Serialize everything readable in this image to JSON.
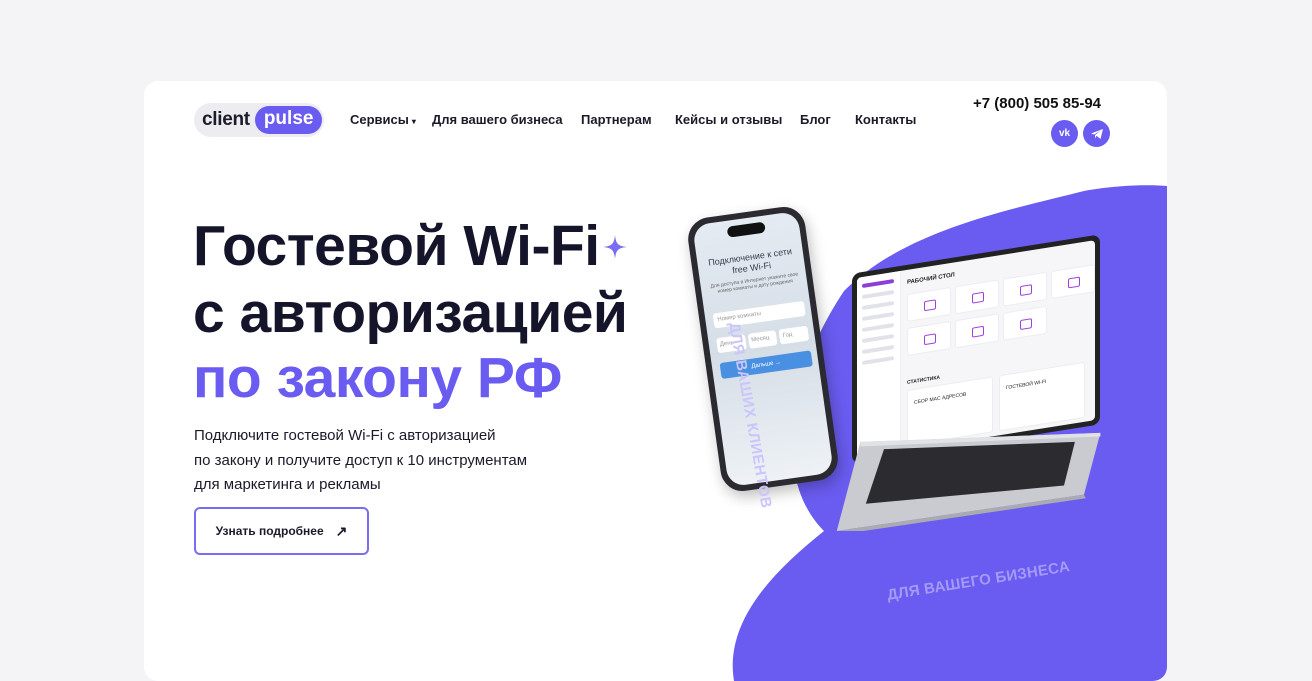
{
  "logo": {
    "word1": "client",
    "word2": "pulse"
  },
  "nav": [
    {
      "label": "Сервисы",
      "has_dropdown": true
    },
    {
      "label": "Для вашего бизнеса"
    },
    {
      "label": "Партнерам"
    },
    {
      "label": "Кейсы и отзывы"
    },
    {
      "label": "Блог"
    },
    {
      "label": "Контакты"
    }
  ],
  "contacts": {
    "phone": "+7 (800) 505 85-94",
    "social": [
      "vk-icon",
      "telegram-icon"
    ]
  },
  "hero": {
    "line1": "Гостевой Wi-Fi",
    "line2": "с авторизацией",
    "line3": "по закону РФ",
    "description": [
      "Подключите гостевой Wi-Fi с авторизацией",
      "по закону и получите доступ к 10 инструментам",
      "для маркетинга и рекламы"
    ],
    "cta_label": "Узнать подробнее"
  },
  "decor": {
    "vertical_caption": "ДЛЯ ВАШИХ КЛИЕНТОВ",
    "horizontal_caption": "ДЛЯ ВАШЕГО БИЗНЕСА"
  },
  "phone_mock": {
    "title": "Подключение к сети free Wi-Fi",
    "desc": "Для доступа в Интернет укажите свое номер комнаты и дату рождения",
    "room_placeholder": "Номер комнаты",
    "day": "День",
    "month": "Месяц",
    "year": "Год",
    "button": "Дальше →"
  },
  "laptop_mock": {
    "title": "РАБОЧИЙ СТОЛ",
    "stats": "СТАТИСТИКА",
    "card1": "СБОР MAC АДРЕСОВ",
    "card2": "ГОСТЕВОЙ WI-FI"
  },
  "colors": {
    "accent": "#6a5cf0",
    "text": "#14142a",
    "background": "#f4f4f6"
  }
}
